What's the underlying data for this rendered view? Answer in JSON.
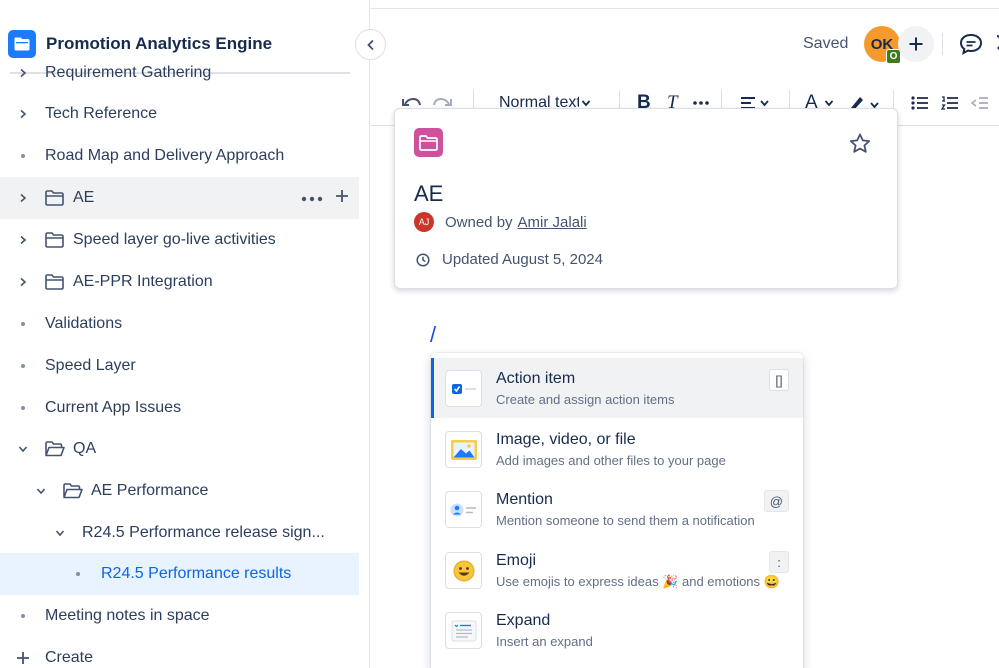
{
  "space": {
    "title": "Promotion Analytics Engine"
  },
  "tree": {
    "items": [
      {
        "label": "Requirement Gathering",
        "kind": "chevron-right"
      },
      {
        "label": "Tech Reference",
        "kind": "chevron-right"
      },
      {
        "label": "Road Map and Delivery Approach",
        "kind": "bullet"
      },
      {
        "label": "AE",
        "kind": "folder"
      },
      {
        "label": "Speed layer go-live activities",
        "kind": "folder"
      },
      {
        "label": "AE-PPR Integration",
        "kind": "folder"
      },
      {
        "label": "Validations",
        "kind": "bullet"
      },
      {
        "label": "Speed Layer",
        "kind": "bullet"
      },
      {
        "label": "Current App Issues",
        "kind": "bullet"
      },
      {
        "label": "QA",
        "kind": "folder-open"
      },
      {
        "label": "AE Performance",
        "kind": "folder-open"
      },
      {
        "label": "R24.5 Performance release sign...",
        "kind": "chevron-down"
      },
      {
        "label": "R24.5 Performance results",
        "kind": "bullet"
      },
      {
        "label": "Meeting notes in space",
        "kind": "bullet"
      },
      {
        "label": "Create",
        "kind": "plus"
      }
    ]
  },
  "topbar": {
    "saved_label": "Saved",
    "avatar_initials": "OK",
    "avatar_badge": "O"
  },
  "toolbar": {
    "text_style": "Normal text"
  },
  "card": {
    "title": "AE",
    "owner_prefix": "Owned by",
    "owner_name": "Amir Jalali",
    "owner_initials": "AJ",
    "updated": "Updated August 5, 2024"
  },
  "editor": {
    "slash": "/"
  },
  "slash_menu": {
    "items": [
      {
        "title": "Action item",
        "desc": "Create and assign action items",
        "shortcut": "[]",
        "icon": "checkbox-icon"
      },
      {
        "title": "Image, video, or file",
        "desc": "Add images and other files to your page",
        "shortcut": "",
        "icon": "image-icon"
      },
      {
        "title": "Mention",
        "desc": "Mention someone to send them a notification",
        "shortcut": "@",
        "icon": "mention-icon"
      },
      {
        "title": "Emoji",
        "desc": "Use emojis to express ideas 🎉 and emotions 😀",
        "shortcut": ":",
        "icon": "emoji-icon"
      },
      {
        "title": "Expand",
        "desc": "Insert an expand",
        "shortcut": "",
        "icon": "expand-icon"
      }
    ]
  },
  "colors": {
    "brand": "#1d7afc",
    "selected": "#e9f2ff",
    "accent": "#0c66e4",
    "page_icon": "#cd519d"
  }
}
